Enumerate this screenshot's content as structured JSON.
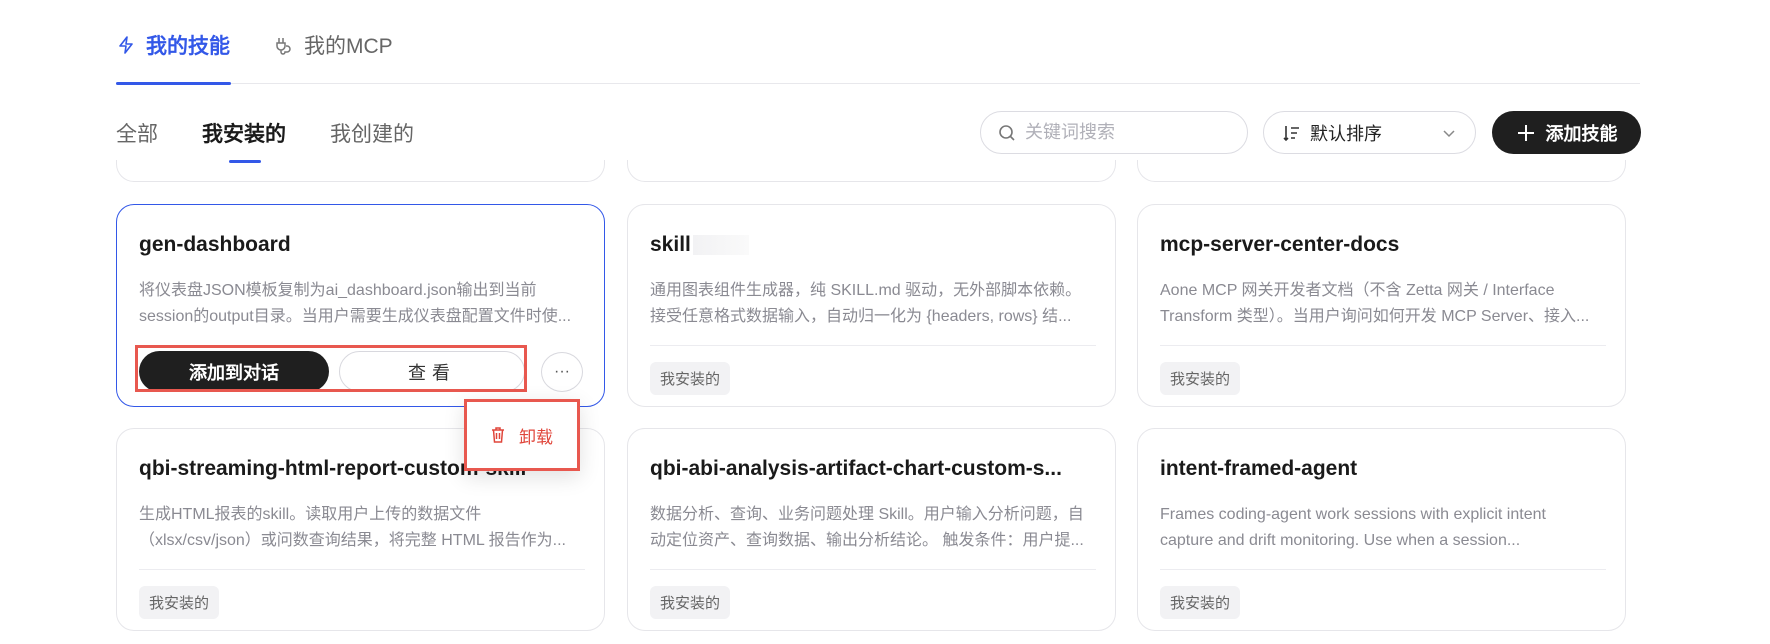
{
  "top_tabs": [
    {
      "label": "我的技能",
      "icon": "lightning-icon",
      "active": true
    },
    {
      "label": "我的MCP",
      "icon": "plug-icon",
      "active": false
    }
  ],
  "sub_tabs": [
    {
      "label": "全部",
      "active": false
    },
    {
      "label": "我安装的",
      "active": true
    },
    {
      "label": "我创建的",
      "active": false
    }
  ],
  "search": {
    "placeholder": "关键词搜索",
    "icon": "search-icon"
  },
  "sort": {
    "label": "默认排序",
    "icon": "sort-icon"
  },
  "add_button": {
    "label": "添加技能",
    "icon": "plus-icon"
  },
  "accent_color": "#3358e8",
  "cards": [
    {
      "title": "gen-dashboard",
      "desc_line1": "将仪表盘JSON模板复制为ai_dashboard.json输出到当前",
      "desc_line2": "session的output目录。当用户需要生成仪表盘配置文件时使...",
      "selected": true,
      "actions": {
        "primary": "添加到对话",
        "secondary": "查看",
        "more": "···"
      }
    },
    {
      "title": "skill",
      "desc_line1": "通用图表组件生成器，纯 SKILL.md 驱动，无外部脚本依赖。",
      "desc_line2": "接受任意格式数据输入，自动归一化为 {headers, rows} 结...",
      "tag": "我安装的"
    },
    {
      "title": "mcp-server-center-docs",
      "desc_line1": "Aone MCP 网关开发者文档（不含 Zetta 网关 / Interface",
      "desc_line2": "Transform 类型）。当用户询问如何开发 MCP Server、接入...",
      "tag": "我安装的"
    },
    {
      "title": "qbi-streaming-html-report-custom-skill",
      "desc_line1": "生成HTML报表的skill。读取用户上传的数据文件",
      "desc_line2": "（xlsx/csv/json）或问数查询结果，将完整 HTML 报告作为...",
      "tag": "我安装的"
    },
    {
      "title": "qbi-abi-analysis-artifact-chart-custom-s...",
      "desc_line1": "数据分析、查询、业务问题处理 Skill。用户输入分析问题，自",
      "desc_line2": "动定位资产、查询数据、输出分析结论。 触发条件：用户提...",
      "tag": "我安装的"
    },
    {
      "title": "intent-framed-agent",
      "desc_line1": "Frames coding-agent work sessions with explicit intent",
      "desc_line2": "capture and drift monitoring. Use when a session...",
      "tag": "我安装的"
    }
  ],
  "popup": {
    "label": "卸载",
    "icon": "trash-icon"
  }
}
